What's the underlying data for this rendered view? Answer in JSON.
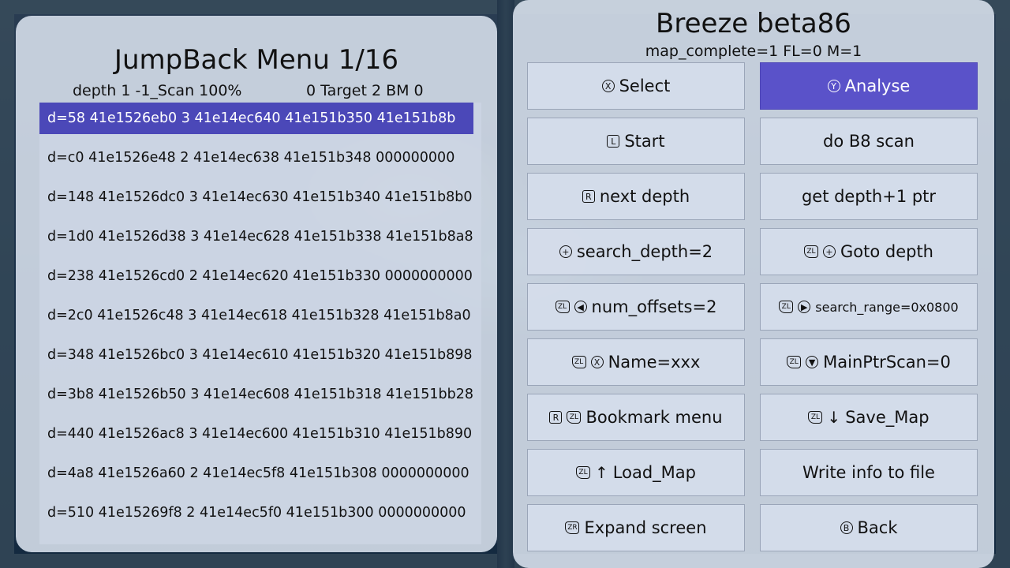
{
  "left": {
    "title": "JumpBack Menu 1/16",
    "status_left": "depth 1 -1_Scan 100%",
    "status_right": "0 Target 2 BM 0",
    "items": [
      "d=58 41e1526eb0 3 41e14ec640 41e151b350 41e151b8b",
      "d=c0 41e1526e48 2 41e14ec638 41e151b348 000000000",
      "d=148 41e1526dc0 3 41e14ec630 41e151b340 41e151b8b0",
      "d=1d0 41e1526d38 3 41e14ec628 41e151b338 41e151b8a8",
      "d=238 41e1526cd0 2 41e14ec620 41e151b330 0000000000",
      "d=2c0 41e1526c48 3 41e14ec618 41e151b328 41e151b8a0",
      "d=348 41e1526bc0 3 41e14ec610 41e151b320 41e151b898",
      "d=3b8 41e1526b50 3 41e14ec608 41e151b318 41e151bb28",
      "d=440 41e1526ac8 3 41e14ec600 41e151b310 41e151b890",
      "d=4a8 41e1526a60 2 41e14ec5f8 41e151b308 0000000000",
      "d=510 41e15269f8 2 41e14ec5f0 41e151b300 0000000000"
    ]
  },
  "right": {
    "title": "Breeze beta86",
    "subtitle": "map_complete=1 FL=0 M=1",
    "buttons": [
      {
        "glyph": "X",
        "glyph_name": "x-button-icon",
        "label": "Select"
      },
      {
        "glyph": "Y",
        "glyph_name": "y-button-icon",
        "label": "Analyse"
      },
      {
        "glyph": "L",
        "glyph_name": "l-button-icon",
        "label": "Start"
      },
      {
        "glyph": "",
        "glyph_name": "",
        "label": "do B8 scan"
      },
      {
        "glyph": "R",
        "glyph_name": "r-button-icon",
        "label": "next depth"
      },
      {
        "glyph": "",
        "glyph_name": "",
        "label": "get depth+1 ptr"
      },
      {
        "glyph": "+",
        "glyph_name": "plus-button-icon",
        "label": "search_depth=2"
      },
      {
        "glyph": "ZL +",
        "glyph_name": "zl-plus-icon",
        "label": "Goto depth"
      },
      {
        "glyph": "ZL ◀",
        "glyph_name": "zl-dpad-left-icon",
        "label": "num_offsets=2"
      },
      {
        "glyph": "ZL ▶",
        "glyph_name": "zl-dpad-right-icon",
        "label": "search_range=0x0800"
      },
      {
        "glyph": "ZL X",
        "glyph_name": "zl-x-icon",
        "label": "Name=xxx"
      },
      {
        "glyph": "ZL ▼",
        "glyph_name": "zl-dpad-down-icon",
        "label": "MainPtrScan=0"
      },
      {
        "glyph": "R ZL",
        "glyph_name": "r-zl-icon",
        "label": "Bookmark menu"
      },
      {
        "glyph": "ZL ↓",
        "glyph_name": "zl-down-arrow-icon",
        "label": "Save_Map"
      },
      {
        "glyph": "ZL ↑",
        "glyph_name": "zl-up-arrow-icon",
        "label": "Load_Map"
      },
      {
        "glyph": "",
        "glyph_name": "",
        "label": "Write info to file"
      },
      {
        "glyph": "ZR",
        "glyph_name": "zr-button-icon",
        "label": "Expand screen"
      },
      {
        "glyph": "B",
        "glyph_name": "b-button-icon",
        "label": "Back"
      }
    ]
  },
  "colors": {
    "selection": "#4b48b8",
    "active_button": "#5a52c9",
    "panel": "#dee6f2"
  }
}
